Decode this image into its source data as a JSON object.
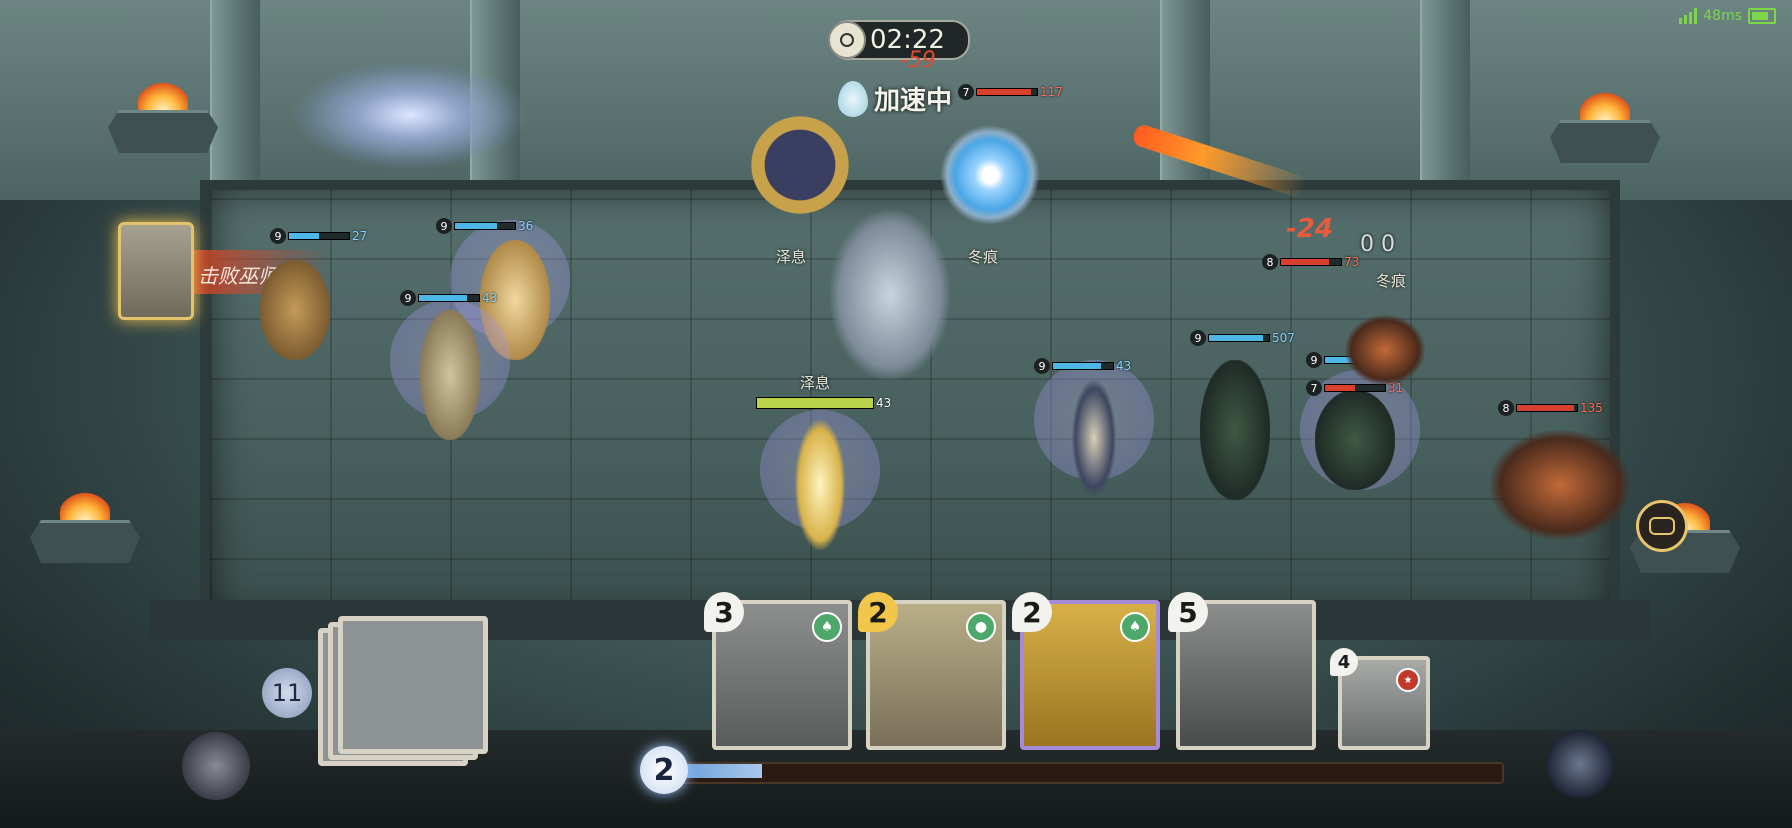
{
  "hud": {
    "timer": "02:22",
    "timer_delta": "-59",
    "speed_status": "加速中",
    "ping": "48ms"
  },
  "notification": {
    "defeat_text": "击败巫师!"
  },
  "portraits": [
    {
      "name": "泽息"
    },
    {
      "name": "冬痕"
    }
  ],
  "enemy_hero": {
    "name": "冬痕",
    "hp_display": "0 0"
  },
  "ally_hero": {
    "name": "泽息",
    "level": "9",
    "hp": "43"
  },
  "units": [
    {
      "level": "9",
      "hp": "27",
      "side": "ally"
    },
    {
      "level": "9",
      "hp": "36",
      "side": "ally"
    },
    {
      "level": "9",
      "hp": "43",
      "side": "ally"
    },
    {
      "level": "9",
      "hp": "43",
      "side": "ally"
    },
    {
      "level": "9",
      "hp": "507",
      "side": "ally"
    },
    {
      "level": "9",
      "hp": "19",
      "side": "ally"
    },
    {
      "level": "7",
      "hp": "117",
      "side": "enemy"
    },
    {
      "level": "8",
      "hp": "73",
      "side": "enemy"
    },
    {
      "level": "7",
      "hp": "31",
      "side": "enemy"
    },
    {
      "level": "8",
      "hp": "135",
      "side": "enemy"
    }
  ],
  "damage_numbers": [
    "-24"
  ],
  "deck": {
    "remaining": "11"
  },
  "hand": [
    {
      "cost": "3",
      "type_icon": "companion-icon"
    },
    {
      "cost": "2",
      "type_icon": "spell-icon"
    },
    {
      "cost": "2",
      "type_icon": "companion-icon"
    },
    {
      "cost": "5",
      "type_icon": "companion-icon"
    },
    {
      "cost": "4",
      "type_icon": "badge-icon"
    }
  ],
  "mana": {
    "current": "2",
    "fill_fraction": 0.1
  },
  "colors": {
    "ally_hp": "#4db8e8",
    "enemy_hp": "#d8402c",
    "mana": "#9cc4ff"
  }
}
